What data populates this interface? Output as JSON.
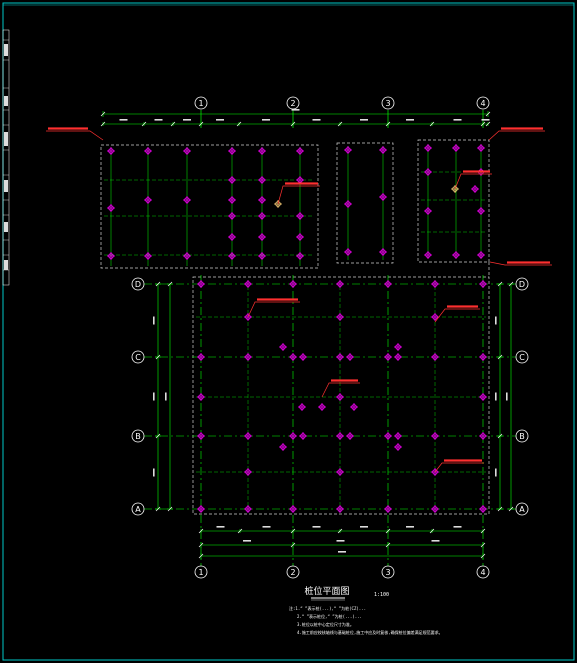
{
  "colors": {
    "background": "#000000",
    "frame": "#00c8c8",
    "grid_line": "#00ff00",
    "pile_marker": "#ff00ff",
    "callout": "#ff3030",
    "outline": "#d0d0d0",
    "text": "#ffffff",
    "pile_special": "#ffd27a"
  },
  "drawing": {
    "title": "桩位平面图",
    "scale": "1:100",
    "notes": [
      "注:1.“   ”表示桩(...),“   ”为桩(CZ)...",
      "2.“   ”表示桩位,“   ”为桩(...)...",
      "3.桩位以桩中心定位尺寸为准。",
      "4.施工前应校核轴线与基础桩位,施工中应及时复核,确保桩位偏差满足规范要求。"
    ]
  },
  "axes": {
    "numbered": [
      "1",
      "2",
      "3",
      "4"
    ],
    "lettered": [
      "D",
      "C",
      "B",
      "A"
    ]
  }
}
